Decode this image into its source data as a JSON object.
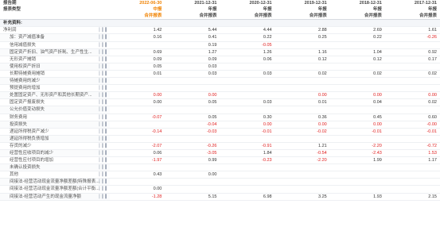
{
  "header": {
    "row1_label": "报告期",
    "row2_label": "报表类型",
    "periods": [
      "2022-06-30",
      "2021-12-31",
      "2020-12-31",
      "2019-12-31",
      "2018-12-31",
      "2017-12-31"
    ],
    "types": [
      "中报",
      "年报",
      "年报",
      "年报",
      "年报",
      "年报"
    ],
    "scopes": [
      "合并报表",
      "合并报表",
      "合并报表",
      "合并报表",
      "合并报表",
      "合并报表"
    ]
  },
  "section_title": "补充资料:",
  "rows": [
    {
      "label": "净利润",
      "values": [
        "1.42",
        "5.44",
        "4.44",
        "2.88",
        "2.69",
        "1.61"
      ],
      "neg": [
        0,
        0,
        0,
        0,
        0,
        0
      ]
    },
    {
      "label": "加：资产减值准备",
      "values": [
        "0.16",
        "0.41",
        "0.22",
        "0.25",
        "0.22",
        "-0.26"
      ],
      "neg": [
        0,
        0,
        0,
        0,
        0,
        1
      ]
    },
    {
      "label": "信用减值损失",
      "values": [
        "",
        "0.19",
        "-0.05",
        "",
        "",
        ""
      ],
      "neg": [
        0,
        0,
        1,
        0,
        0,
        0
      ]
    },
    {
      "label": "固定资产折旧、油气资产折耗、生产性生...",
      "values": [
        "0.69",
        "1.27",
        "1.26",
        "1.16",
        "1.04",
        "0.92"
      ],
      "neg": [
        0,
        0,
        0,
        0,
        0,
        0
      ]
    },
    {
      "label": "无形资产摊销",
      "values": [
        "0.09",
        "0.09",
        "0.06",
        "0.12",
        "0.12",
        "0.17"
      ],
      "neg": [
        0,
        0,
        0,
        0,
        0,
        0
      ]
    },
    {
      "label": "使用权资产折旧",
      "values": [
        "0.05",
        "0.03",
        "",
        "",
        "",
        ""
      ],
      "neg": [
        0,
        0,
        0,
        0,
        0,
        0
      ]
    },
    {
      "label": "长期待摊费用摊销",
      "values": [
        "0.01",
        "0.03",
        "0.03",
        "0.02",
        "0.02",
        "0.02"
      ],
      "neg": [
        0,
        0,
        0,
        0,
        0,
        0
      ]
    },
    {
      "label": "待摊费用的减少",
      "values": [
        "",
        "",
        "",
        "",
        "",
        ""
      ],
      "neg": [
        0,
        0,
        0,
        0,
        0,
        0
      ]
    },
    {
      "label": "预提费用的增加",
      "values": [
        "",
        "",
        "",
        "",
        "",
        ""
      ],
      "neg": [
        0,
        0,
        0,
        0,
        0,
        0
      ]
    },
    {
      "label": "处置固定资产、无形资产和其他长期资产...",
      "values": [
        "0.00",
        "0.00",
        "",
        "0.00",
        "0.00",
        "0.00"
      ],
      "neg": [
        1,
        1,
        0,
        1,
        1,
        1
      ]
    },
    {
      "label": "固定资产报废损失",
      "values": [
        "0.00",
        "0.05",
        "0.03",
        "0.01",
        "0.04",
        "0.02"
      ],
      "neg": [
        0,
        0,
        0,
        0,
        0,
        0
      ]
    },
    {
      "label": "公允价值变动损失",
      "values": [
        "",
        "",
        "",
        "",
        "",
        ""
      ],
      "neg": [
        0,
        0,
        0,
        0,
        0,
        0
      ]
    },
    {
      "label": "财务费用",
      "values": [
        "-0.07",
        "0.05",
        "0.30",
        "0.36",
        "0.45",
        "0.60"
      ],
      "neg": [
        1,
        0,
        0,
        0,
        0,
        0
      ]
    },
    {
      "label": "投资损失",
      "values": [
        "",
        "-0.04",
        "0.00",
        "0.00",
        "0.00",
        "-0.00"
      ],
      "neg": [
        0,
        1,
        1,
        1,
        1,
        1
      ]
    },
    {
      "label": "递延所得税资产减少",
      "values": [
        "-0.14",
        "-0.03",
        "-0.01",
        "-0.02",
        "-0.01",
        "-0.01"
      ],
      "neg": [
        1,
        1,
        1,
        1,
        1,
        1
      ]
    },
    {
      "label": "递延所得税负债增加",
      "values": [
        "",
        "",
        "",
        "",
        "",
        ""
      ],
      "neg": [
        0,
        0,
        0,
        0,
        0,
        0
      ]
    },
    {
      "label": "存货的减少",
      "values": [
        "-2.07",
        "-0.26",
        "-0.91",
        "1.21",
        "-2.20",
        "-0.72"
      ],
      "neg": [
        1,
        1,
        1,
        0,
        1,
        1
      ]
    },
    {
      "label": "经营性应收项目的减少",
      "values": [
        "0.06",
        "-3.05",
        "1.84",
        "-0.54",
        "-2.43",
        "1.53"
      ],
      "neg": [
        0,
        1,
        0,
        1,
        1,
        1
      ]
    },
    {
      "label": "经营性应付项目的增加",
      "values": [
        "-1.97",
        "0.99",
        "-0.23",
        "-2.20",
        "1.99",
        "1.17"
      ],
      "neg": [
        1,
        0,
        1,
        1,
        0,
        0
      ]
    },
    {
      "label": "未确认投资损失",
      "values": [
        "",
        "",
        "",
        "",
        "",
        ""
      ],
      "neg": [
        0,
        0,
        0,
        0,
        0,
        0
      ]
    },
    {
      "label": "其他",
      "values": [
        "0.43",
        "0.00",
        "",
        "",
        "",
        ""
      ],
      "neg": [
        0,
        0,
        0,
        0,
        0,
        0
      ]
    },
    {
      "label": "间接法-经营活动现金流量净额差额(特殊报表...",
      "values": [
        "",
        "",
        "",
        "",
        "",
        ""
      ],
      "neg": [
        0,
        0,
        0,
        0,
        0,
        0
      ]
    },
    {
      "label": "间接法-经营活动现金流量净额差额(合计平衡...",
      "values": [
        "0.00",
        "",
        "",
        "",
        "",
        ""
      ],
      "neg": [
        0,
        0,
        0,
        0,
        0,
        0
      ]
    },
    {
      "label": "间接法-经营活动产生的现金流量净额",
      "values": [
        "-1.28",
        "5.15",
        "6.98",
        "3.25",
        "1.93",
        "2.15"
      ],
      "neg": [
        1,
        0,
        0,
        0,
        0,
        0
      ]
    }
  ],
  "chart_icon": "bar-chart-icon",
  "colors": {
    "highlight": "#f08200",
    "negative": "#e02020"
  }
}
